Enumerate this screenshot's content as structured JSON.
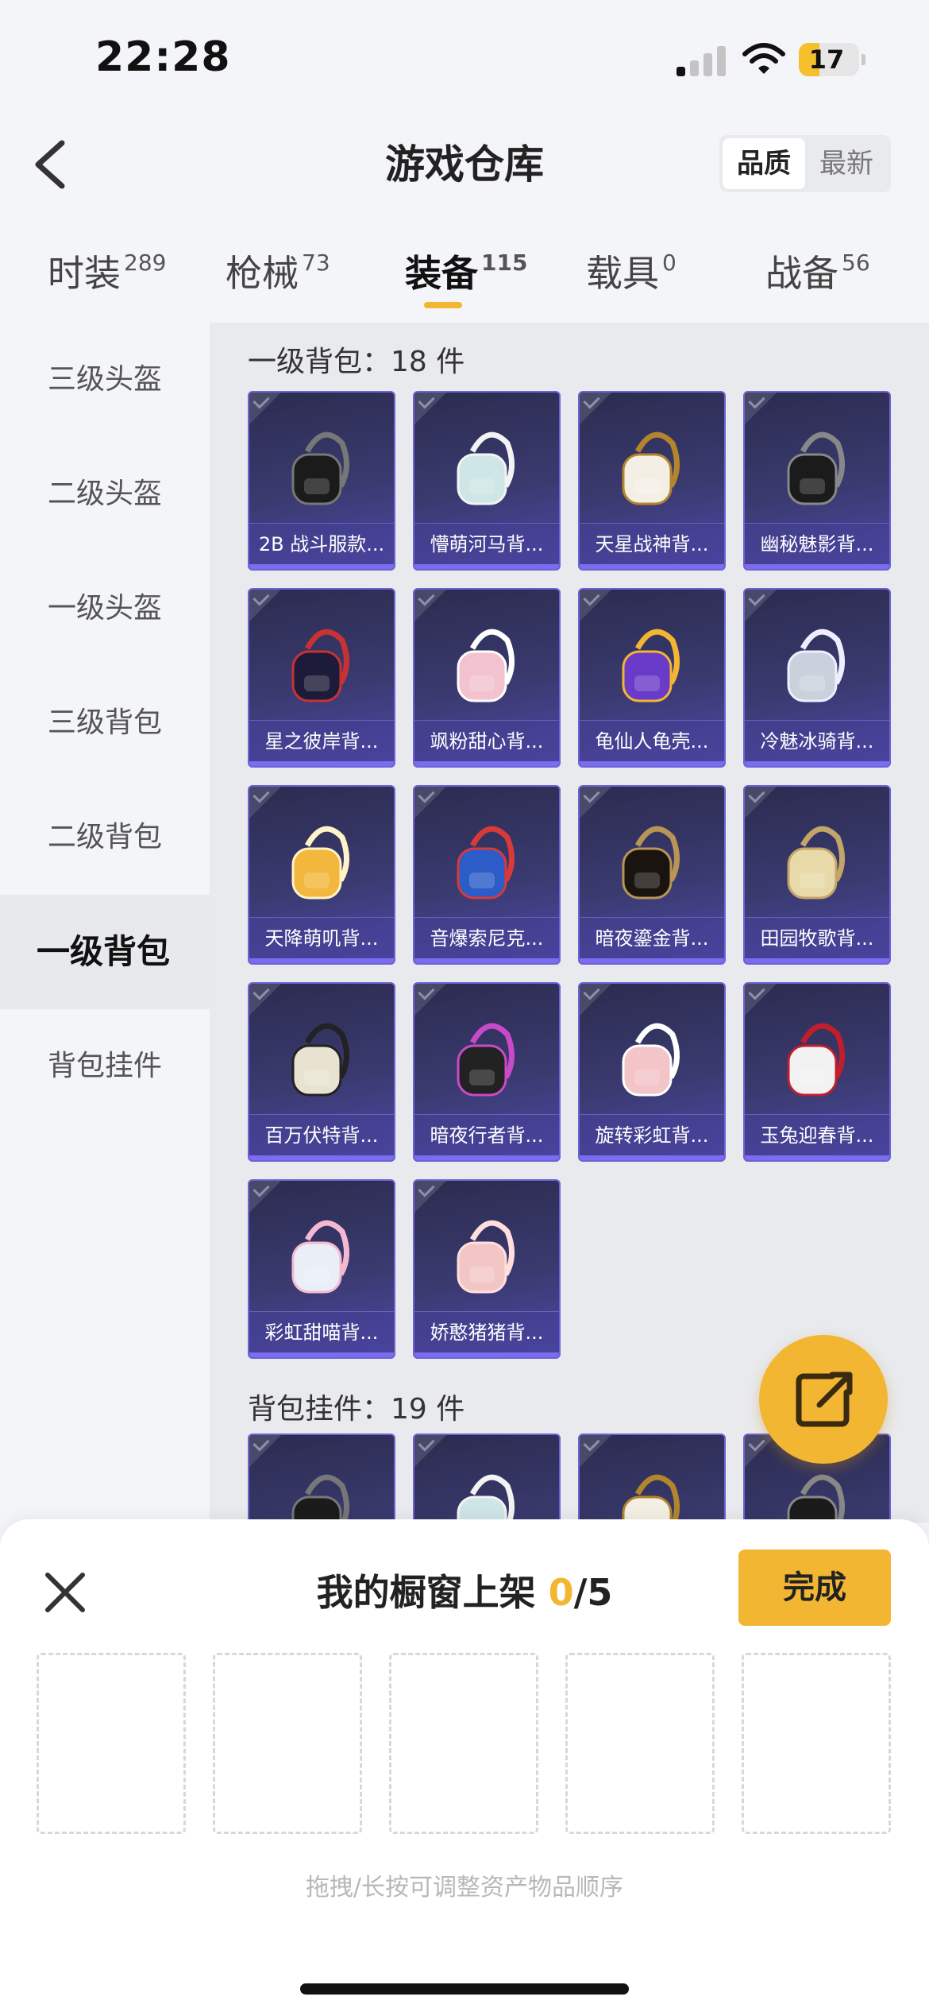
{
  "status_bar": {
    "time": "22:28",
    "battery": "17"
  },
  "header": {
    "title": "游戏仓库",
    "sort_options": [
      "品质",
      "最新"
    ],
    "sort_active": "品质"
  },
  "tabs": [
    {
      "label": "时装",
      "count": "289"
    },
    {
      "label": "枪械",
      "count": "73"
    },
    {
      "label": "装备",
      "count": "115",
      "active": true
    },
    {
      "label": "载具",
      "count": "0"
    },
    {
      "label": "战备",
      "count": "56"
    }
  ],
  "sidebar": {
    "items": [
      "三级头盔",
      "二级头盔",
      "一级头盔",
      "三级背包",
      "二级背包",
      "一级背包",
      "背包挂件"
    ],
    "active": "一级背包"
  },
  "sections": [
    {
      "title": "一级背包：18 件",
      "items": [
        "2B 战斗服款...",
        "懵萌河马背...",
        "天星战神背...",
        "幽秘魅影背...",
        "星之彼岸背...",
        "飒粉甜心背...",
        "龟仙人龟壳...",
        "冷魅冰骑背...",
        "天降萌叽背...",
        "音爆索尼克...",
        "暗夜鎏金背...",
        "田园牧歌背...",
        "百万伏特背...",
        "暗夜行者背...",
        "旋转彩虹背...",
        "玉兔迎春背...",
        "彩虹甜喵背...",
        "娇憨猪猪背..."
      ]
    },
    {
      "title": "背包挂件：19 件",
      "items": [
        "",
        "",
        "",
        ""
      ]
    }
  ],
  "bottom_sheet": {
    "title": "我的橱窗上架",
    "current": "0",
    "total": "/5",
    "done_label": "完成",
    "hint": "拖拽/长按可调整资产物品顺序"
  },
  "colors": {
    "accent": "#f2b633",
    "card_bg": "#3a3a70",
    "card_border": "#6c63d6"
  }
}
